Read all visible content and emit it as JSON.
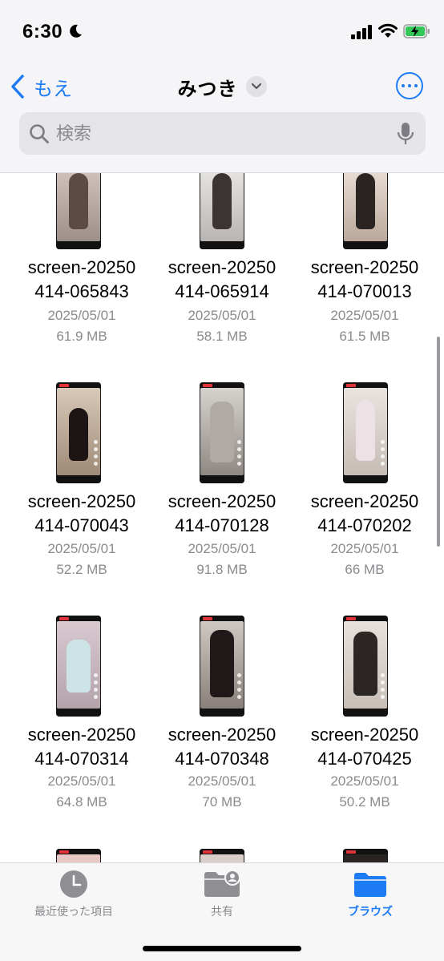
{
  "status_bar": {
    "time": "6:30"
  },
  "header": {
    "back_label": "もえ",
    "title": "みつき"
  },
  "search": {
    "placeholder": "検索"
  },
  "files": [
    {
      "name1": "screen-20250",
      "name2": "414-065843",
      "date": "2025/05/01",
      "size": "61.9 MB"
    },
    {
      "name1": "screen-20250",
      "name2": "414-065914",
      "date": "2025/05/01",
      "size": "58.1 MB"
    },
    {
      "name1": "screen-20250",
      "name2": "414-070013",
      "date": "2025/05/01",
      "size": "61.5 MB"
    },
    {
      "name1": "screen-20250",
      "name2": "414-070043",
      "date": "2025/05/01",
      "size": "52.2 MB"
    },
    {
      "name1": "screen-20250",
      "name2": "414-070128",
      "date": "2025/05/01",
      "size": "91.8 MB"
    },
    {
      "name1": "screen-20250",
      "name2": "414-070202",
      "date": "2025/05/01",
      "size": "66 MB"
    },
    {
      "name1": "screen-20250",
      "name2": "414-070314",
      "date": "2025/05/01",
      "size": "64.8 MB"
    },
    {
      "name1": "screen-20250",
      "name2": "414-070348",
      "date": "2025/05/01",
      "size": "70 MB"
    },
    {
      "name1": "screen-20250",
      "name2": "414-070425",
      "date": "2025/05/01",
      "size": "50.2 MB"
    }
  ],
  "tabbar": {
    "recents": "最近使った項目",
    "shared": "共有",
    "browse": "ブラウズ"
  },
  "colors": {
    "accent": "#1d7bf5",
    "secondary_text": "#8a8a8f"
  }
}
